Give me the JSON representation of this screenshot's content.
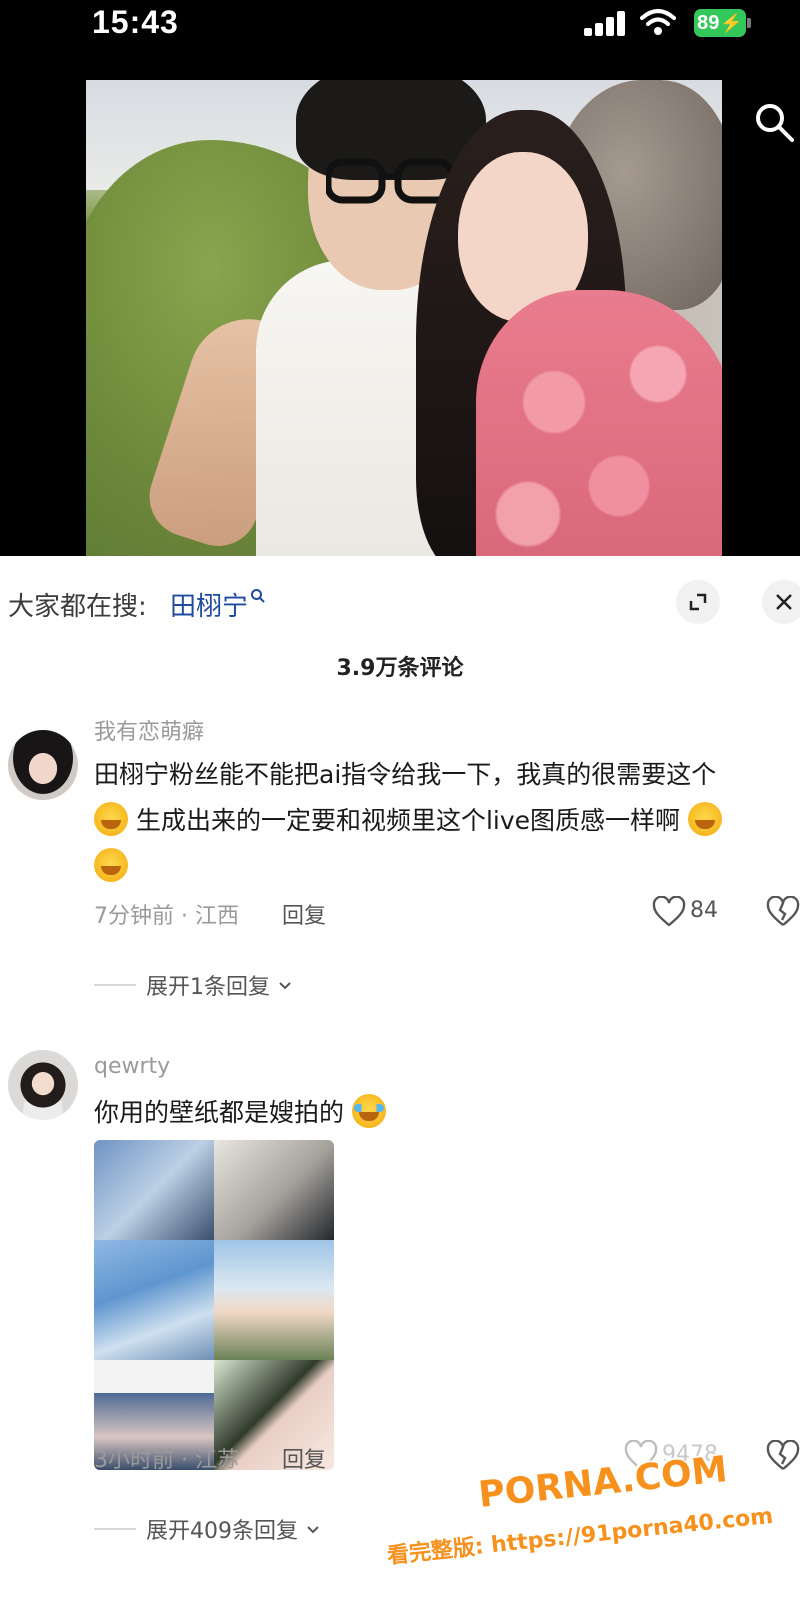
{
  "status_bar": {
    "time": "15:43",
    "battery": "89"
  },
  "search_bar": {
    "prefix": "大家都在搜:",
    "term": "田栩宁"
  },
  "comments_header": {
    "count_label": "3.9万条评论"
  },
  "comments": [
    {
      "username": "我有恋萌癖",
      "text_line1": "田栩宁粉丝能不能把ai指令给我一下，我真的很需要这个",
      "text_line2": "生成出来的一定要和视频里这个live图质感一样啊",
      "meta": "7分钟前 · 江西",
      "reply_label": "回复",
      "likes": "84",
      "expand_label": "展开1条回复"
    },
    {
      "username": "qewrty",
      "text": "你用的壁纸都是嫂拍的",
      "meta": "3小时前 · 江苏",
      "reply_label": "回复",
      "likes": "9478",
      "expand_label": "展开409条回复"
    }
  ],
  "watermark": {
    "logo": "PORNA.COM",
    "url": "看完整版: https://91porna40.com"
  },
  "icons": {
    "search": "search-icon",
    "fullscreen": "fullscreen-icon",
    "close": "close-icon",
    "like": "heart-icon",
    "dislike": "broken-heart-icon"
  },
  "colors": {
    "battery": "#34c759",
    "search_term": "#1f4a9e",
    "watermark": "#f7911e"
  }
}
